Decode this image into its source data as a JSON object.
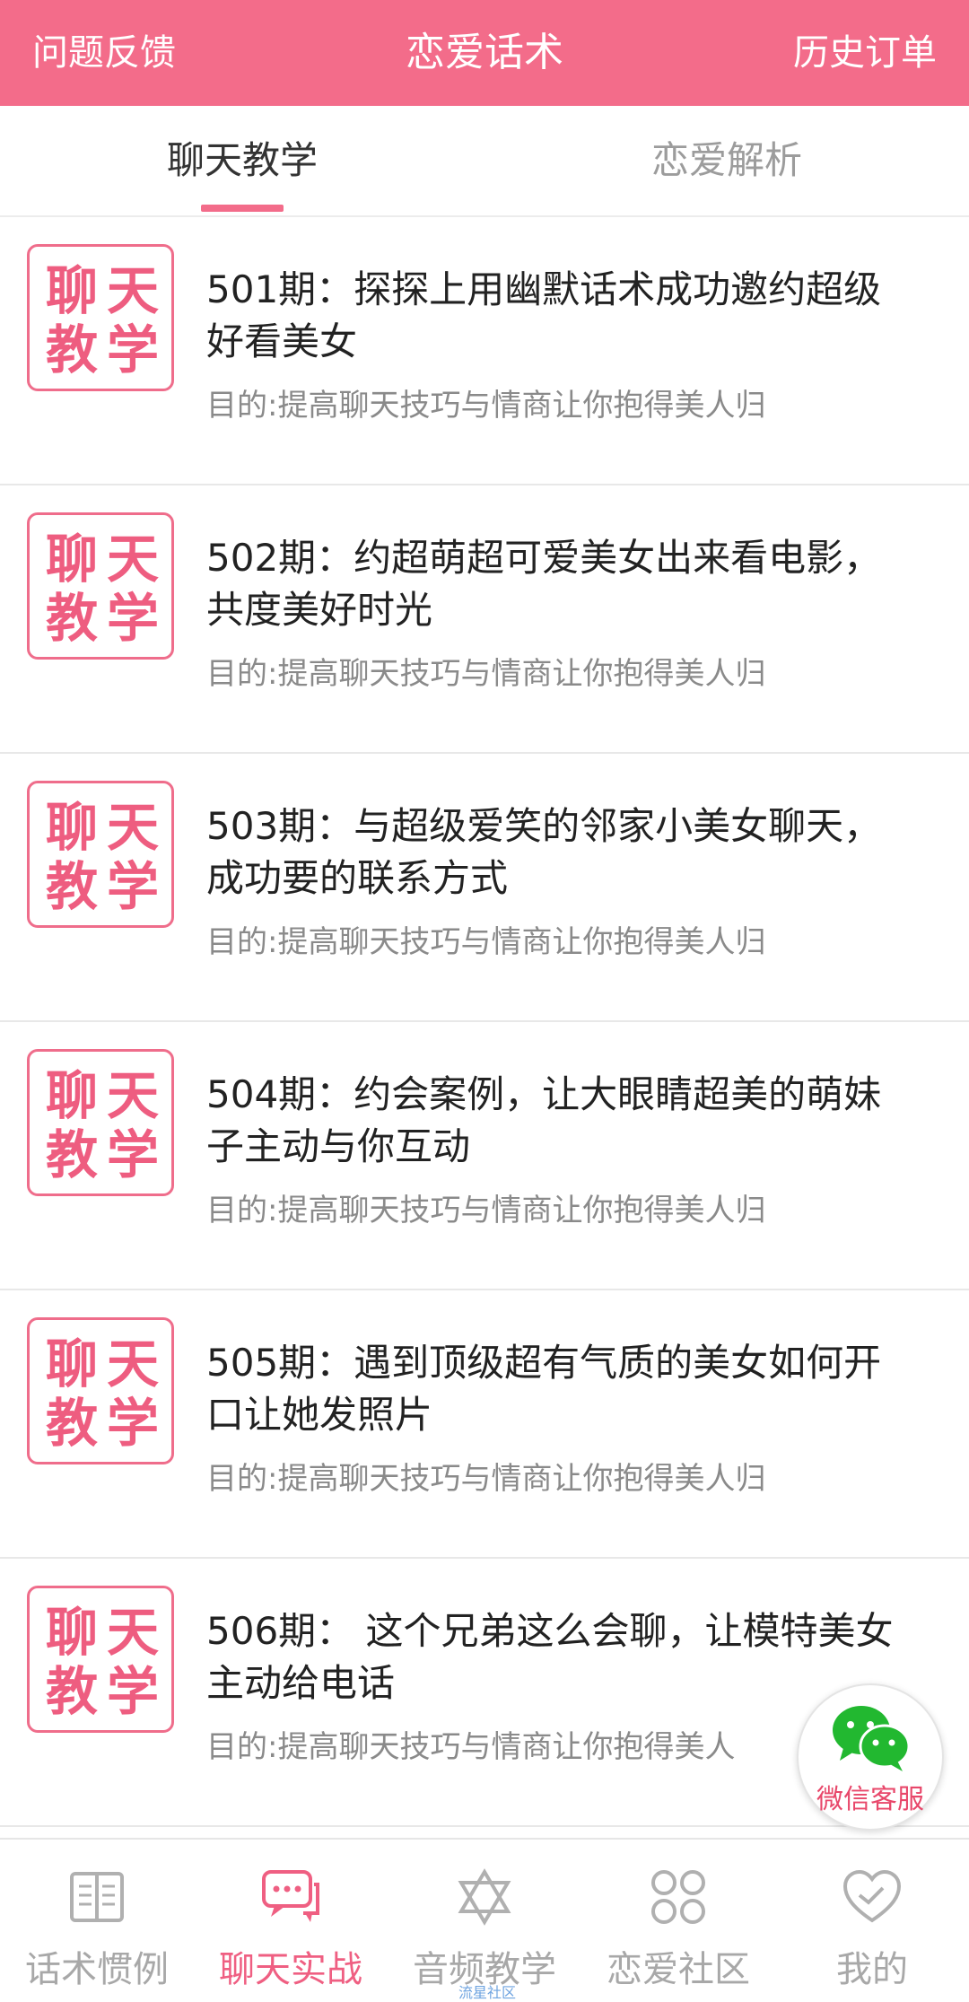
{
  "header": {
    "left_label": "问题反馈",
    "title": "恋爱话术",
    "right_label": "历史订单",
    "color": "#f36c8a"
  },
  "tabs": [
    {
      "label": "聊天教学",
      "active": true
    },
    {
      "label": "恋爱解析",
      "active": false
    }
  ],
  "thumb": {
    "chars": [
      "聊",
      "天",
      "教",
      "学"
    ]
  },
  "items": [
    {
      "title": "501期：探探上用幽默话术成功邀约超级好看美女",
      "subtitle": "目的:提高聊天技巧与情商让你抱得美人归"
    },
    {
      "title": "502期：约超萌超可爱美女出来看电影，共度美好时光",
      "subtitle": "目的:提高聊天技巧与情商让你抱得美人归"
    },
    {
      "title": "503期：与超级爱笑的邻家小美女聊天，成功要的联系方式",
      "subtitle": "目的:提高聊天技巧与情商让你抱得美人归"
    },
    {
      "title": "504期：约会案例，让大眼睛超美的萌妹子主动与你互动",
      "subtitle": "目的:提高聊天技巧与情商让你抱得美人归"
    },
    {
      "title": "505期：遇到顶级超有气质的美女如何开口让她发照片",
      "subtitle": "目的:提高聊天技巧与情商让你抱得美人归"
    },
    {
      "title": "506期： 这个兄弟这么会聊，让模特美女主动给电话",
      "subtitle": "目的:提高聊天技巧与情商让你抱得美人"
    }
  ],
  "wechat": {
    "label": "微信客服",
    "icon": "wechat-icon"
  },
  "bottom_nav": [
    {
      "label": "话术惯例",
      "icon": "book-icon",
      "active": false
    },
    {
      "label": "聊天实战",
      "icon": "chat-bubble-icon",
      "active": true
    },
    {
      "label": "音频教学",
      "icon": "star-of-david-icon",
      "active": false
    },
    {
      "label": "恋爱社区",
      "icon": "grid-circles-icon",
      "active": false
    },
    {
      "label": "我的",
      "icon": "heart-check-icon",
      "active": false
    }
  ],
  "watermark": "流星社区",
  "colors": {
    "accent": "#f36c8a",
    "active_nav": "#ef5f82",
    "inactive_nav": "#a8a8a8"
  }
}
